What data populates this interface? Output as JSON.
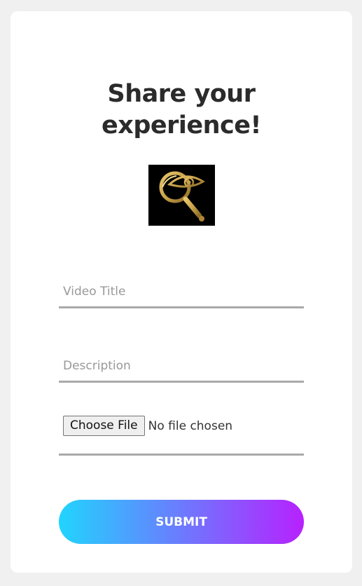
{
  "heading": {
    "line1": "Share your",
    "line2": "experience!"
  },
  "logo": {
    "icon": "eye-magnifier-icon"
  },
  "form": {
    "title_placeholder": "Video Title",
    "title_value": "",
    "description_placeholder": "Description",
    "description_value": "",
    "file_button_label": "Choose File",
    "file_status": "No file chosen",
    "submit_label": "SUBMIT"
  },
  "colors": {
    "page_background": "#f0f0f0",
    "card_background": "#ffffff",
    "heading": "#2b2b2b",
    "underline": "#a9a9a9",
    "gradient_start": "#21d4fd",
    "gradient_end": "#b721ff",
    "logo_gold": "#c9a24a"
  }
}
